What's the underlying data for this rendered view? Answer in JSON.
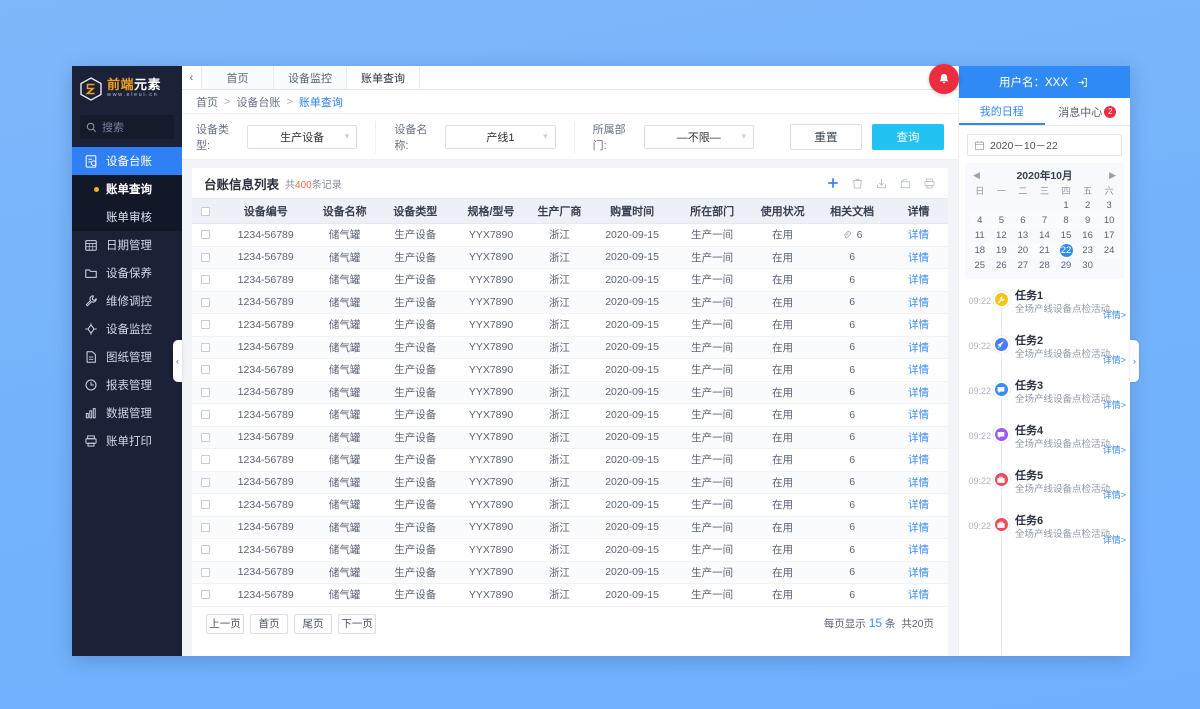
{
  "brand": {
    "cn_orange": "前端",
    "cn_white": "元素",
    "url": "www.eleui.cn"
  },
  "search": {
    "placeholder": "搜索"
  },
  "sidebar": {
    "active_item": "设备台账",
    "items": [
      {
        "label": "设备台账",
        "icon": "clipboard-check-icon"
      },
      {
        "label": "日期管理",
        "icon": "calendar-icon"
      },
      {
        "label": "设备保养",
        "icon": "folder-icon"
      },
      {
        "label": "维修调控",
        "icon": "wrench-icon"
      },
      {
        "label": "设备监控",
        "icon": "target-icon"
      },
      {
        "label": "图纸管理",
        "icon": "document-icon"
      },
      {
        "label": "报表管理",
        "icon": "clock-icon"
      },
      {
        "label": "数据管理",
        "icon": "bar-chart-icon"
      },
      {
        "label": "账单打印",
        "icon": "printer-icon"
      }
    ],
    "subitems": [
      {
        "label": "账单查询",
        "selected": true
      },
      {
        "label": "账单审核",
        "selected": false
      }
    ]
  },
  "tabs": [
    {
      "label": "首页",
      "active": false
    },
    {
      "label": "设备监控",
      "active": false
    },
    {
      "label": "账单查询",
      "active": true
    }
  ],
  "breadcrumb": {
    "items": [
      "首页",
      "设备台账",
      "账单查询"
    ],
    "separator": ">"
  },
  "filters": {
    "fields": [
      {
        "label": "设备类型:",
        "value": "生产设备"
      },
      {
        "label": "设备名称:",
        "value": "产线1"
      },
      {
        "label": "所属部门:",
        "value": "—不限—"
      }
    ],
    "reset_label": "重置",
    "query_label": "查询"
  },
  "panel": {
    "title": "台账信息列表",
    "count_prefix": "共",
    "count": "400",
    "count_suffix": "条记录",
    "tools": [
      {
        "name": "add-icon",
        "title": "新增"
      },
      {
        "name": "delete-icon",
        "title": "删除"
      },
      {
        "name": "download-icon",
        "title": "下载"
      },
      {
        "name": "export-icon",
        "title": "导出"
      },
      {
        "name": "print-icon",
        "title": "打印"
      }
    ]
  },
  "table": {
    "columns": [
      "",
      "设备编号",
      "设备名称",
      "设备类型",
      "规格/型号",
      "生产厂商",
      "购置时间",
      "所在部门",
      "使用状况",
      "相关文档",
      "详情"
    ],
    "detail_label": "详情",
    "rows": [
      {
        "id": "1234-56789",
        "name": "储气罐",
        "type": "生产设备",
        "model": "YYX7890",
        "vendor": "浙江",
        "date": "2020-09-15",
        "dept": "生产一间",
        "status": "在用",
        "docs": "6",
        "has_clip": true
      },
      {
        "id": "1234-56789",
        "name": "储气罐",
        "type": "生产设备",
        "model": "YYX7890",
        "vendor": "浙江",
        "date": "2020-09-15",
        "dept": "生产一间",
        "status": "在用",
        "docs": "6",
        "has_clip": false
      },
      {
        "id": "1234-56789",
        "name": "储气罐",
        "type": "生产设备",
        "model": "YYX7890",
        "vendor": "浙江",
        "date": "2020-09-15",
        "dept": "生产一间",
        "status": "在用",
        "docs": "6",
        "has_clip": false
      },
      {
        "id": "1234-56789",
        "name": "储气罐",
        "type": "生产设备",
        "model": "YYX7890",
        "vendor": "浙江",
        "date": "2020-09-15",
        "dept": "生产一间",
        "status": "在用",
        "docs": "6",
        "has_clip": false
      },
      {
        "id": "1234-56789",
        "name": "储气罐",
        "type": "生产设备",
        "model": "YYX7890",
        "vendor": "浙江",
        "date": "2020-09-15",
        "dept": "生产一间",
        "status": "在用",
        "docs": "6",
        "has_clip": false
      },
      {
        "id": "1234-56789",
        "name": "储气罐",
        "type": "生产设备",
        "model": "YYX7890",
        "vendor": "浙江",
        "date": "2020-09-15",
        "dept": "生产一间",
        "status": "在用",
        "docs": "6",
        "has_clip": false
      },
      {
        "id": "1234-56789",
        "name": "储气罐",
        "type": "生产设备",
        "model": "YYX7890",
        "vendor": "浙江",
        "date": "2020-09-15",
        "dept": "生产一间",
        "status": "在用",
        "docs": "6",
        "has_clip": false
      },
      {
        "id": "1234-56789",
        "name": "储气罐",
        "type": "生产设备",
        "model": "YYX7890",
        "vendor": "浙江",
        "date": "2020-09-15",
        "dept": "生产一间",
        "status": "在用",
        "docs": "6",
        "has_clip": false
      },
      {
        "id": "1234-56789",
        "name": "储气罐",
        "type": "生产设备",
        "model": "YYX7890",
        "vendor": "浙江",
        "date": "2020-09-15",
        "dept": "生产一间",
        "status": "在用",
        "docs": "6",
        "has_clip": false
      },
      {
        "id": "1234-56789",
        "name": "储气罐",
        "type": "生产设备",
        "model": "YYX7890",
        "vendor": "浙江",
        "date": "2020-09-15",
        "dept": "生产一间",
        "status": "在用",
        "docs": "6",
        "has_clip": false
      },
      {
        "id": "1234-56789",
        "name": "储气罐",
        "type": "生产设备",
        "model": "YYX7890",
        "vendor": "浙江",
        "date": "2020-09-15",
        "dept": "生产一间",
        "status": "在用",
        "docs": "6",
        "has_clip": false
      },
      {
        "id": "1234-56789",
        "name": "储气罐",
        "type": "生产设备",
        "model": "YYX7890",
        "vendor": "浙江",
        "date": "2020-09-15",
        "dept": "生产一间",
        "status": "在用",
        "docs": "6",
        "has_clip": false
      },
      {
        "id": "1234-56789",
        "name": "储气罐",
        "type": "生产设备",
        "model": "YYX7890",
        "vendor": "浙江",
        "date": "2020-09-15",
        "dept": "生产一间",
        "status": "在用",
        "docs": "6",
        "has_clip": false
      },
      {
        "id": "1234-56789",
        "name": "储气罐",
        "type": "生产设备",
        "model": "YYX7890",
        "vendor": "浙江",
        "date": "2020-09-15",
        "dept": "生产一间",
        "status": "在用",
        "docs": "6",
        "has_clip": false
      },
      {
        "id": "1234-56789",
        "name": "储气罐",
        "type": "生产设备",
        "model": "YYX7890",
        "vendor": "浙江",
        "date": "2020-09-15",
        "dept": "生产一间",
        "status": "在用",
        "docs": "6",
        "has_clip": false
      },
      {
        "id": "1234-56789",
        "name": "储气罐",
        "type": "生产设备",
        "model": "YYX7890",
        "vendor": "浙江",
        "date": "2020-09-15",
        "dept": "生产一间",
        "status": "在用",
        "docs": "6",
        "has_clip": false
      },
      {
        "id": "1234-56789",
        "name": "储气罐",
        "type": "生产设备",
        "model": "YYX7890",
        "vendor": "浙江",
        "date": "2020-09-15",
        "dept": "生产一间",
        "status": "在用",
        "docs": "6",
        "has_clip": false
      }
    ]
  },
  "pagination": {
    "buttons": [
      "上一页",
      "首页",
      "尾页",
      "下一页"
    ],
    "per_page_prefix": "每页显示",
    "per_page": "15",
    "per_page_suffix": "条",
    "total_pages": "共20页"
  },
  "userbar": {
    "user_label": "用户名：XXX",
    "bell_icon": "bell-icon",
    "logout_icon": "logout-icon"
  },
  "right_tabs": [
    {
      "label": "我的日程",
      "active": true,
      "badge": ""
    },
    {
      "label": "消息中心",
      "active": false,
      "badge": "2"
    }
  ],
  "date_picker": {
    "value": "2020－10－22",
    "icon": "calendar-icon"
  },
  "calendar": {
    "title": "2020年10月",
    "prev": "◀",
    "next": "▶",
    "weekdays": [
      "日",
      "一",
      "二",
      "三",
      "四",
      "五",
      "六"
    ],
    "selected_day": 22,
    "weeks": [
      [
        "",
        "",
        "",
        "",
        "1",
        "2",
        "3"
      ],
      [
        "4",
        "5",
        "6",
        "7",
        "8",
        "9",
        "10"
      ],
      [
        "11",
        "12",
        "13",
        "14",
        "15",
        "16",
        "17"
      ],
      [
        "18",
        "19",
        "20",
        "21",
        "22",
        "23",
        "24"
      ],
      [
        "25",
        "26",
        "27",
        "28",
        "29",
        "30",
        ""
      ]
    ]
  },
  "tasks": {
    "more_label": "详情>",
    "items": [
      {
        "time": "09:22",
        "title": "任务1",
        "desc": "全场产线设备点检活动…",
        "icon": "wrench-icon",
        "color": "#f5c518"
      },
      {
        "time": "09:22",
        "title": "任务2",
        "desc": "全场产线设备点检活动…",
        "icon": "rocket-icon",
        "color": "#4a7dfb"
      },
      {
        "time": "09:22",
        "title": "任务3",
        "desc": "全场产线设备点检活动…",
        "icon": "chat-icon",
        "color": "#3a8cf5"
      },
      {
        "time": "09:22",
        "title": "任务4",
        "desc": "全场产线设备点检活动…",
        "icon": "chat-icon",
        "color": "#9b5cf0"
      },
      {
        "time": "09:22",
        "title": "任务5",
        "desc": "全场产线设备点检活动…",
        "icon": "briefcase-icon",
        "color": "#ec4b5a"
      },
      {
        "time": "09:22",
        "title": "任务6",
        "desc": "全场产线设备点检活动…",
        "icon": "briefcase-icon",
        "color": "#ec4b5a"
      }
    ]
  },
  "handles": {
    "left": "‹",
    "right": "›"
  }
}
